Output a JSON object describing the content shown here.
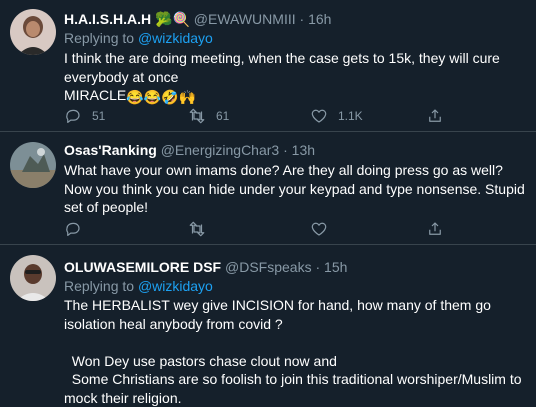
{
  "tweets": [
    {
      "name": "H.A.I.S.H.A.H",
      "handle": "@EWAWUNMIII",
      "time": "16h",
      "reply_prefix": "Replying to ",
      "reply_to": "@wizkidayo",
      "text": "I think the are doing meeting, when the case gets to 15k, they will cure everybody at once\nMIRACLE",
      "emoji": "😂😂🤣🙌",
      "replies": "51",
      "retweets": "61",
      "likes": "1.1K"
    },
    {
      "name": "Osas'Ranking",
      "handle": "@EnergizingChar3",
      "time": "13h",
      "text": "What have your own imams done? Are they all doing press go as well? Now you think you can hide under your keypad and type nonsense. Stupid set of people!"
    },
    {
      "name": "OLUWASEMILORE DSF",
      "handle": "@DSFspeaks",
      "time": "15h",
      "reply_prefix": "Replying to ",
      "reply_to": "@wizkidayo",
      "text": "The HERBALIST wey give INCISION for hand, how many of them go isolation heal anybody from covid ?\n\n  Won Dey use pastors chase clout now and\n  Some Christians are so foolish to join this traditional worshiper/Muslim to mock their religion."
    }
  ],
  "theme": {
    "background": "#15202b",
    "muted": "#8899a6",
    "accent": "#1da1f2",
    "divider": "#38444d"
  },
  "icons": [
    "reply-icon",
    "retweet-icon",
    "like-icon",
    "share-icon"
  ]
}
